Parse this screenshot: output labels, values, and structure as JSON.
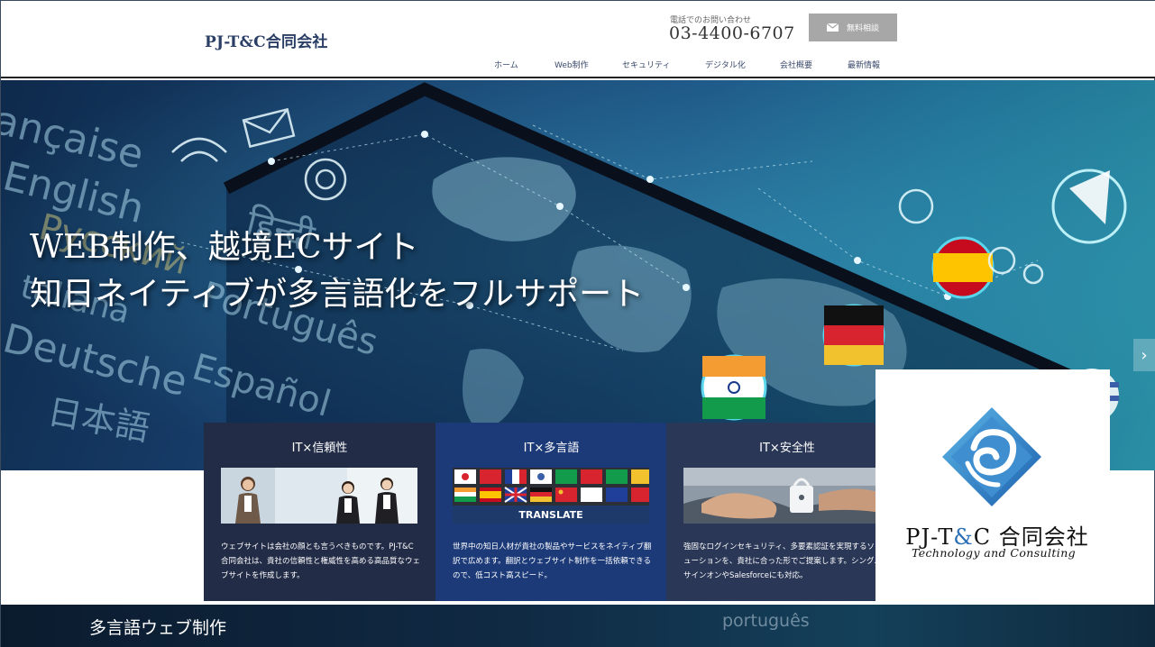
{
  "header": {
    "logo": "PJ-T&C合同会社",
    "phone_caption": "電話でのお問い合わせ",
    "phone_number": "03-4400-6707",
    "consult_button": "無料相談",
    "nav": [
      {
        "label": "ホーム"
      },
      {
        "label": "Web制作"
      },
      {
        "label": "セキュリティ"
      },
      {
        "label": "デジタル化"
      },
      {
        "label": "会社概要"
      },
      {
        "label": "最新情報"
      }
    ]
  },
  "hero": {
    "title_line1": "WEB制作、越境ECサイト",
    "title_line2": "知日ネイティブが多言語化をフルサポート",
    "bg_words": [
      "ançaise",
      "English",
      "Русский",
      "taliana",
      "Deutsche",
      "Português",
      "Español",
      "日本語",
      "हिन्दी"
    ],
    "next_arrow": "›"
  },
  "cards": [
    {
      "title": "IT×信頼性",
      "text": "ウェブサイトは会社の顔とも言うべきものです。PJ-T&C合同会社は、貴社の信頼性と権威性を高める高品質なウェブサイトを作成します。"
    },
    {
      "title": "IT×多言語",
      "image_caption": "TRANSLATE",
      "text": "世界中の知日人材が貴社の製品やサービスをネイティブ翻訳で広めます。翻訳とウェブサイト制作を一括依頼できるので、低コスト高スピード。"
    },
    {
      "title": "IT×安全性",
      "text": "強固なログインセキュリティ、多要素認証を実現するソリューションを、貴社に合った形でご提案します。シングルサインオンやSalesforceにも対応。"
    }
  ],
  "logo_box": {
    "name_prefix": "PJ-T",
    "name_amp": "&",
    "name_suffix": "C 合同会社",
    "subtitle": "Technology and Consulting"
  },
  "section": {
    "title": "多言語ウェブ制作",
    "bg_word": "português"
  },
  "colors": {
    "brand": "#2b3f66",
    "card1": "#232c47",
    "card2": "#1c3a78",
    "card3": "#2a3756",
    "button": "#a7a7a7",
    "logo_blue": "#2b6fb6"
  }
}
